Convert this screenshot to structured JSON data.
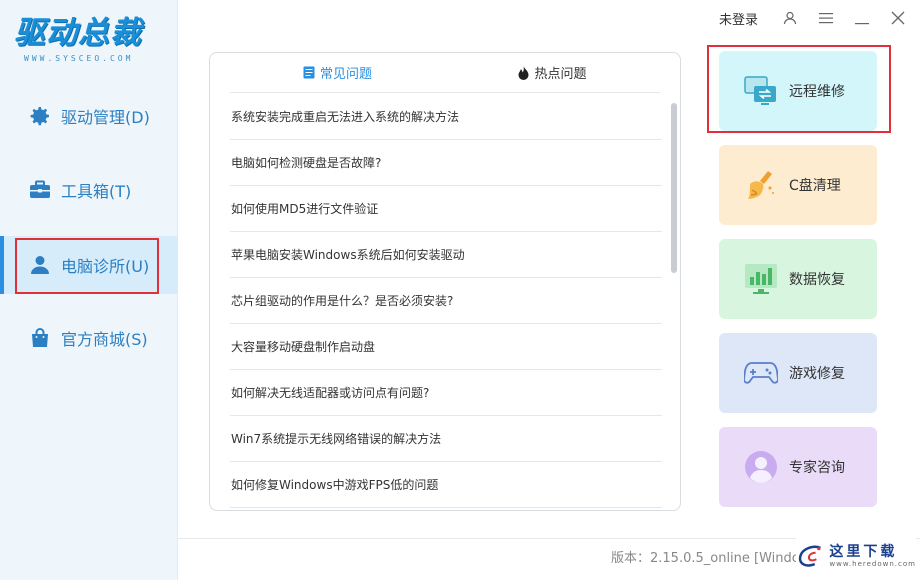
{
  "app": {
    "logo_text": "驱动总裁",
    "logo_sub": "WWW.SYSCEO.COM"
  },
  "topbar": {
    "login_label": "未登录"
  },
  "sidebar": {
    "items": [
      {
        "label": "驱动管理(D)",
        "icon": "gear-icon"
      },
      {
        "label": "工具箱(T)",
        "icon": "toolbox-icon"
      },
      {
        "label": "电脑诊所(U)",
        "icon": "user-icon",
        "active": true
      },
      {
        "label": "官方商城(S)",
        "icon": "shopping-bag-icon"
      }
    ]
  },
  "faq": {
    "tabs": [
      {
        "label": "常见问题",
        "icon": "document-icon",
        "active": true
      },
      {
        "label": "热点问题",
        "icon": "fire-icon"
      }
    ],
    "items": [
      "系统安装完成重启无法进入系统的解决方法",
      "电脑如何检测硬盘是否故障?",
      "如何使用MD5进行文件验证",
      "苹果电脑安装Windows系统后如何安装驱动",
      "芯片组驱动的作用是什么？是否必须安装?",
      "大容量移动硬盘制作启动盘",
      "如何解决无线适配器或访问点有问题?",
      "Win7系统提示无线网络错误的解决方法",
      "如何修复Windows中游戏FPS低的问题"
    ]
  },
  "services": [
    {
      "label": "远程维修",
      "icon": "remote-repair-icon",
      "bg": "#d3f6fb",
      "accent": "#3aa8c8"
    },
    {
      "label": "C盘清理",
      "icon": "broom-icon",
      "bg": "#fdeccf",
      "accent": "#f0a030"
    },
    {
      "label": "数据恢复",
      "icon": "data-chart-icon",
      "bg": "#d8f5df",
      "accent": "#49b866"
    },
    {
      "label": "游戏修复",
      "icon": "gamepad-icon",
      "bg": "#dde7f8",
      "accent": "#5a7fc8"
    },
    {
      "label": "专家咨询",
      "icon": "expert-avatar-icon",
      "bg": "#eadcf8",
      "accent": "#a07ad8"
    }
  ],
  "footer": {
    "version": "版本：2.15.0.5_online [Window"
  },
  "watermark": {
    "text": "这里下载",
    "sub": "www.heredown.com"
  },
  "colors": {
    "brand": "#2a8fe0",
    "highlight_box": "#e0303a"
  }
}
